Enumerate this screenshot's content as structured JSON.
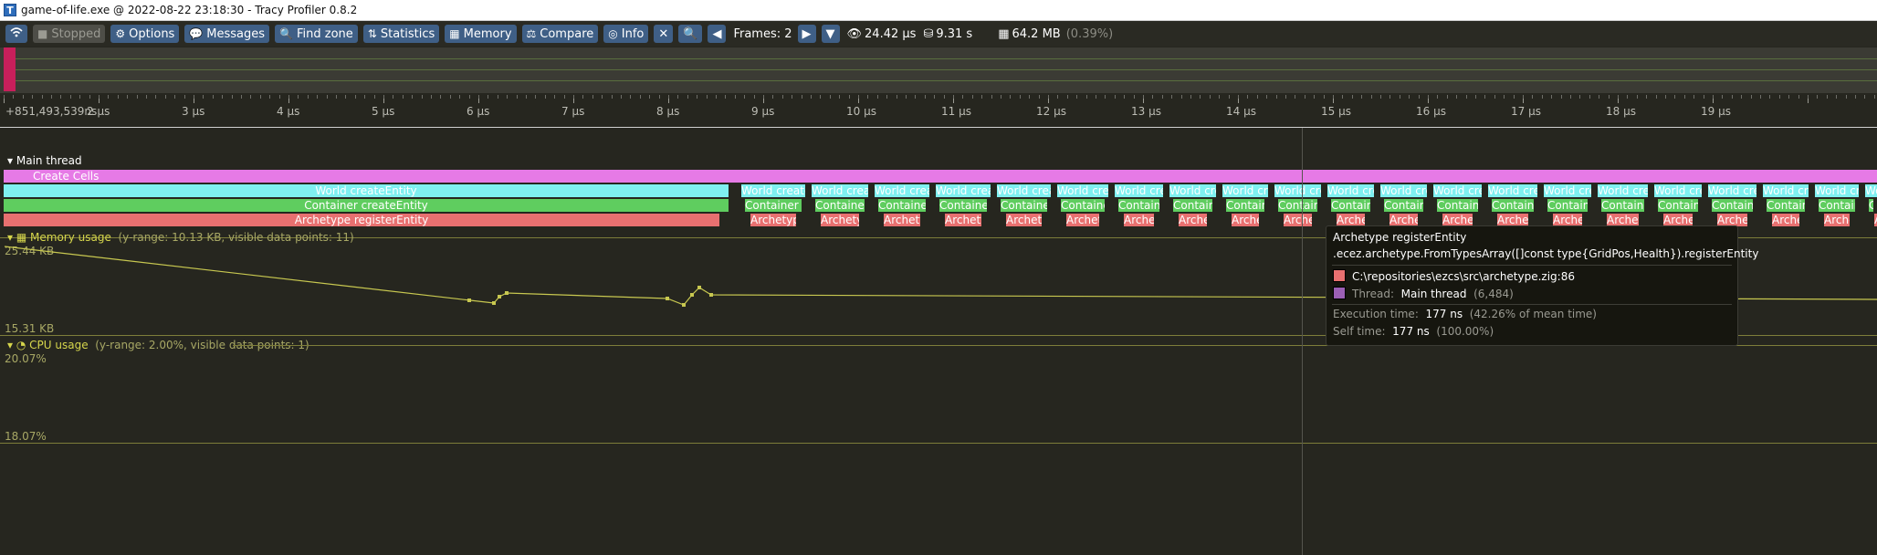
{
  "window": {
    "title": "game-of-life.exe @ 2022-08-22 23:18:30 - Tracy Profiler 0.8.2",
    "icon_letter": "T"
  },
  "toolbar": {
    "stopped": "Stopped",
    "options": "Options",
    "messages": "Messages",
    "find_zone": "Find zone",
    "statistics": "Statistics",
    "memory": "Memory",
    "compare": "Compare",
    "info": "Info",
    "frames": "Frames: 2",
    "view_time": "24.42 μs",
    "total_time": "9.31 s",
    "memory_usage": "64.2 MB",
    "memory_percent": "(0.39%)"
  },
  "timeline": {
    "start_label": "+851,493,539ns",
    "tick_labels": [
      "2 μs",
      "3 μs",
      "4 μs",
      "5 μs",
      "6 μs",
      "7 μs",
      "8 μs",
      "9 μs",
      "10 μs",
      "11 μs",
      "12 μs",
      "13 μs",
      "14 μs",
      "15 μs",
      "16 μs",
      "17 μs",
      "18 μs",
      "19 μs"
    ]
  },
  "main_thread": {
    "label": "Main thread",
    "zones": {
      "create_cells": "Create Cells",
      "world_create": "World createEntity",
      "container_create": "Container createEntity",
      "archetype_register": "Archetype registerEntity",
      "world_short": "World createEntity",
      "container_short": "Container createEntity",
      "archetype_short": "Archetype registerEntity"
    }
  },
  "memory_plot": {
    "title": "Memory usage",
    "meta": "(y-range: 10.13 KB, visible data points: 11)",
    "max_label": "25.44 KB",
    "min_label": "15.31 KB"
  },
  "cpu_plot": {
    "title": "CPU usage",
    "meta": "(y-range: 2.00%, visible data points: 1)",
    "max_label": "20.07%",
    "min_label": "18.07%"
  },
  "tooltip": {
    "name": "Archetype registerEntity",
    "function": ".ecez.archetype.FromTypesArray([]const type{GridPos,Health}).registerEntity",
    "source": "C:\\repositories\\ezcs\\src\\archetype.zig:86",
    "thread_label": "Thread:",
    "thread_name": "Main thread",
    "thread_id": "(6,484)",
    "exec_label": "Execution time:",
    "exec_value": "177 ns",
    "exec_pct": "(42.26% of mean time)",
    "self_label": "Self time:",
    "self_value": "177 ns",
    "self_pct": "(100.00%)",
    "source_color": "#e87070",
    "thread_color": "#9b5fb5"
  },
  "colors": {
    "create_cells": "#e67ae6",
    "world": "#7ff0f0",
    "container": "#5fcd5f",
    "archetype": "#e87070",
    "plot_line": "#c8c850"
  }
}
